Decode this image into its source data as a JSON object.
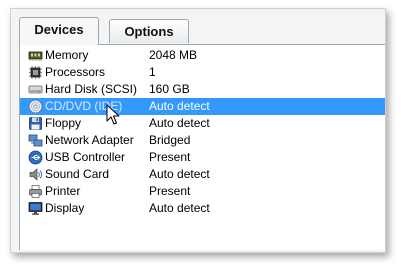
{
  "tabs": [
    {
      "label": "Devices",
      "active": true
    },
    {
      "label": "Options",
      "active": false
    }
  ],
  "devices": [
    {
      "icon": "memory-icon",
      "name": "Memory",
      "value": "2048 MB"
    },
    {
      "icon": "processor-icon",
      "name": "Processors",
      "value": "1"
    },
    {
      "icon": "hard-disk-icon",
      "name": "Hard Disk (SCSI)",
      "value": "160 GB"
    },
    {
      "icon": "cd-dvd-icon",
      "name": "CD/DVD (IDE)",
      "value": "Auto detect",
      "selected": true
    },
    {
      "icon": "floppy-icon",
      "name": "Floppy",
      "value": "Auto detect"
    },
    {
      "icon": "network-adapter-icon",
      "name": "Network Adapter",
      "value": "Bridged"
    },
    {
      "icon": "usb-icon",
      "name": "USB Controller",
      "value": "Present"
    },
    {
      "icon": "sound-card-icon",
      "name": "Sound Card",
      "value": "Auto detect"
    },
    {
      "icon": "printer-icon",
      "name": "Printer",
      "value": "Present"
    },
    {
      "icon": "display-icon",
      "name": "Display",
      "value": "Auto detect"
    }
  ],
  "colors": {
    "selection": "#3399ff",
    "tab_border": "#9aa7b5"
  }
}
